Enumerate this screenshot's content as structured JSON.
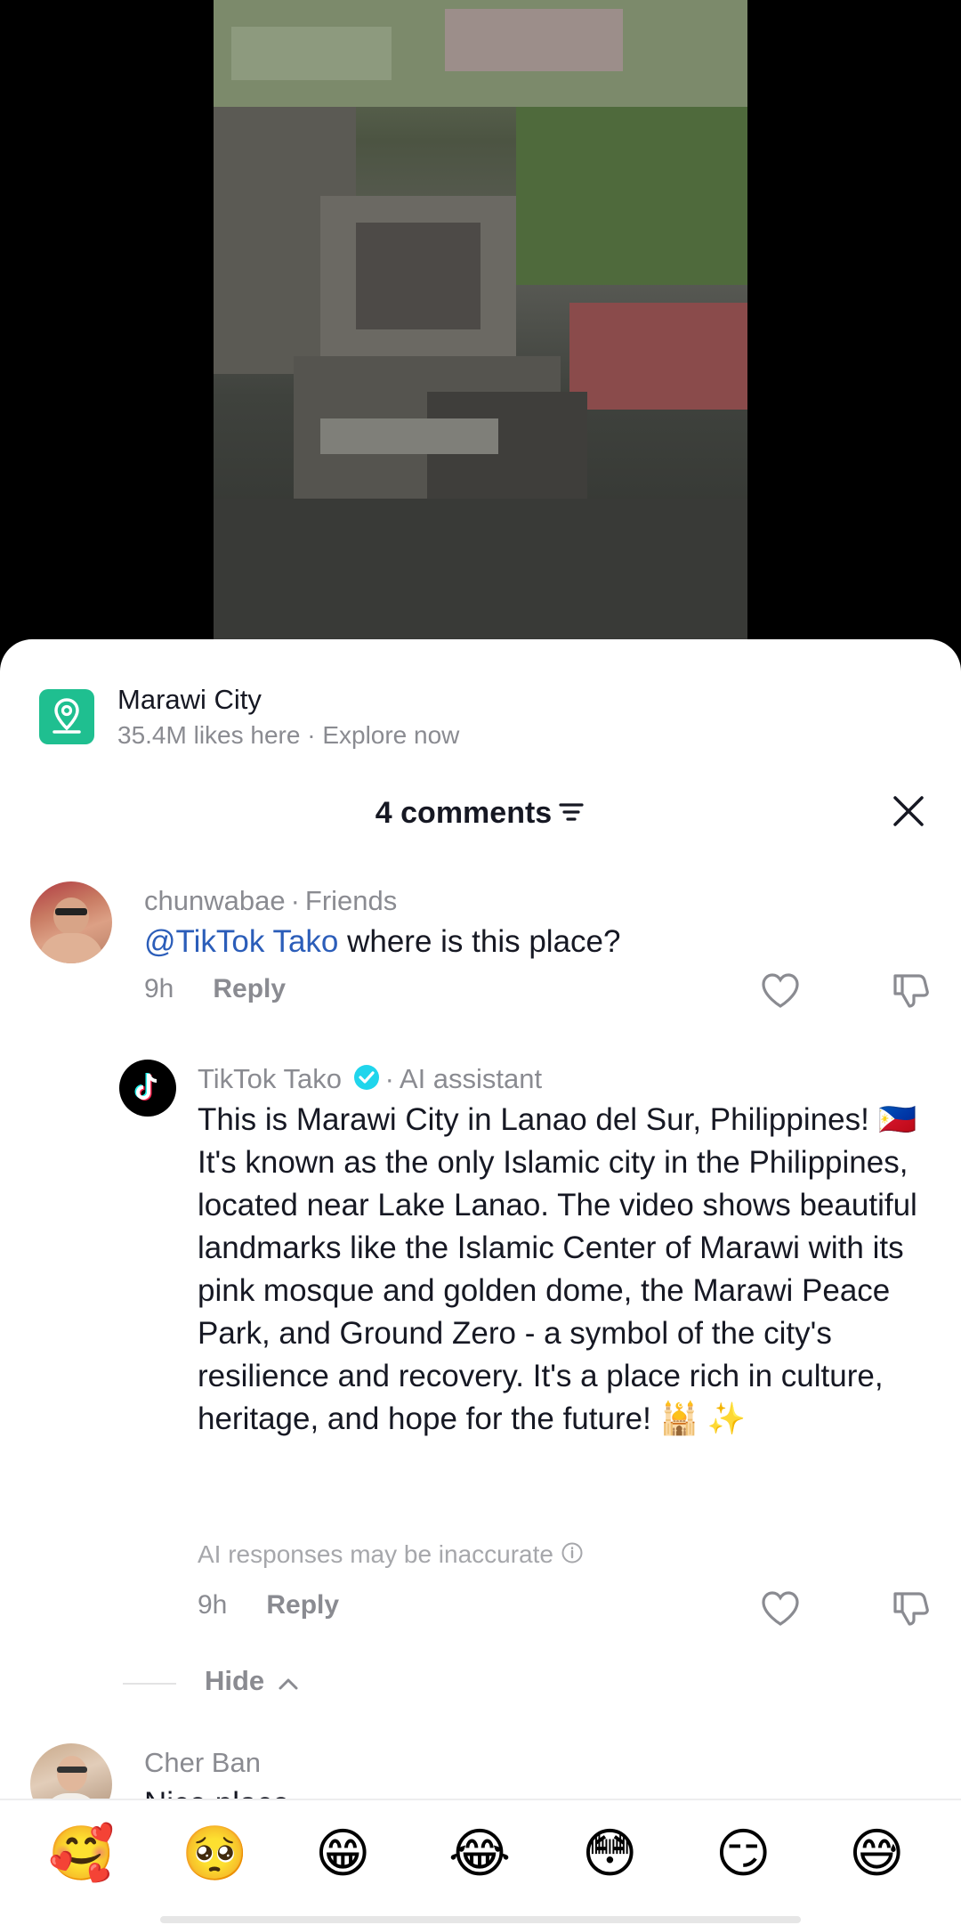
{
  "location": {
    "title": "Marawi City",
    "subtitle": "35.4M likes here · Explore now"
  },
  "comments_header": {
    "count_label": "4 comments"
  },
  "comments": [
    {
      "username": "chunwabae",
      "relation": "Friends",
      "mention": "@TikTok Tako",
      "text": " where is this place?",
      "time": "9h",
      "reply_label": "Reply"
    },
    {
      "username": "TikTok Tako",
      "relation": "AI assistant",
      "text": "This is Marawi City in Lanao del Sur, Philippines! 🇵🇭 It's known as the only Islamic city in the Philippines, located near Lake Lanao. The video shows beautiful landmarks like the Islamic Center of Marawi with its pink mosque and golden dome, the Marawi Peace Park, and Ground Zero - a symbol of the city's resilience and recovery. It's a place rich in culture, heritage, and hope for the future! 🕌 ✨",
      "disclaimer": "AI responses may be inaccurate",
      "time": "9h",
      "reply_label": "Reply"
    },
    {
      "username": "Cher Ban",
      "text": "Nice place"
    }
  ],
  "hide_label": "Hide",
  "emoji_bar": [
    "🥰",
    "🥺",
    "😁",
    "😂",
    "😳",
    "😏",
    "😅"
  ],
  "colors": {
    "accent_link": "#2b5db9",
    "location_icon": "#1fbf90",
    "verified": "#20d5ec"
  }
}
